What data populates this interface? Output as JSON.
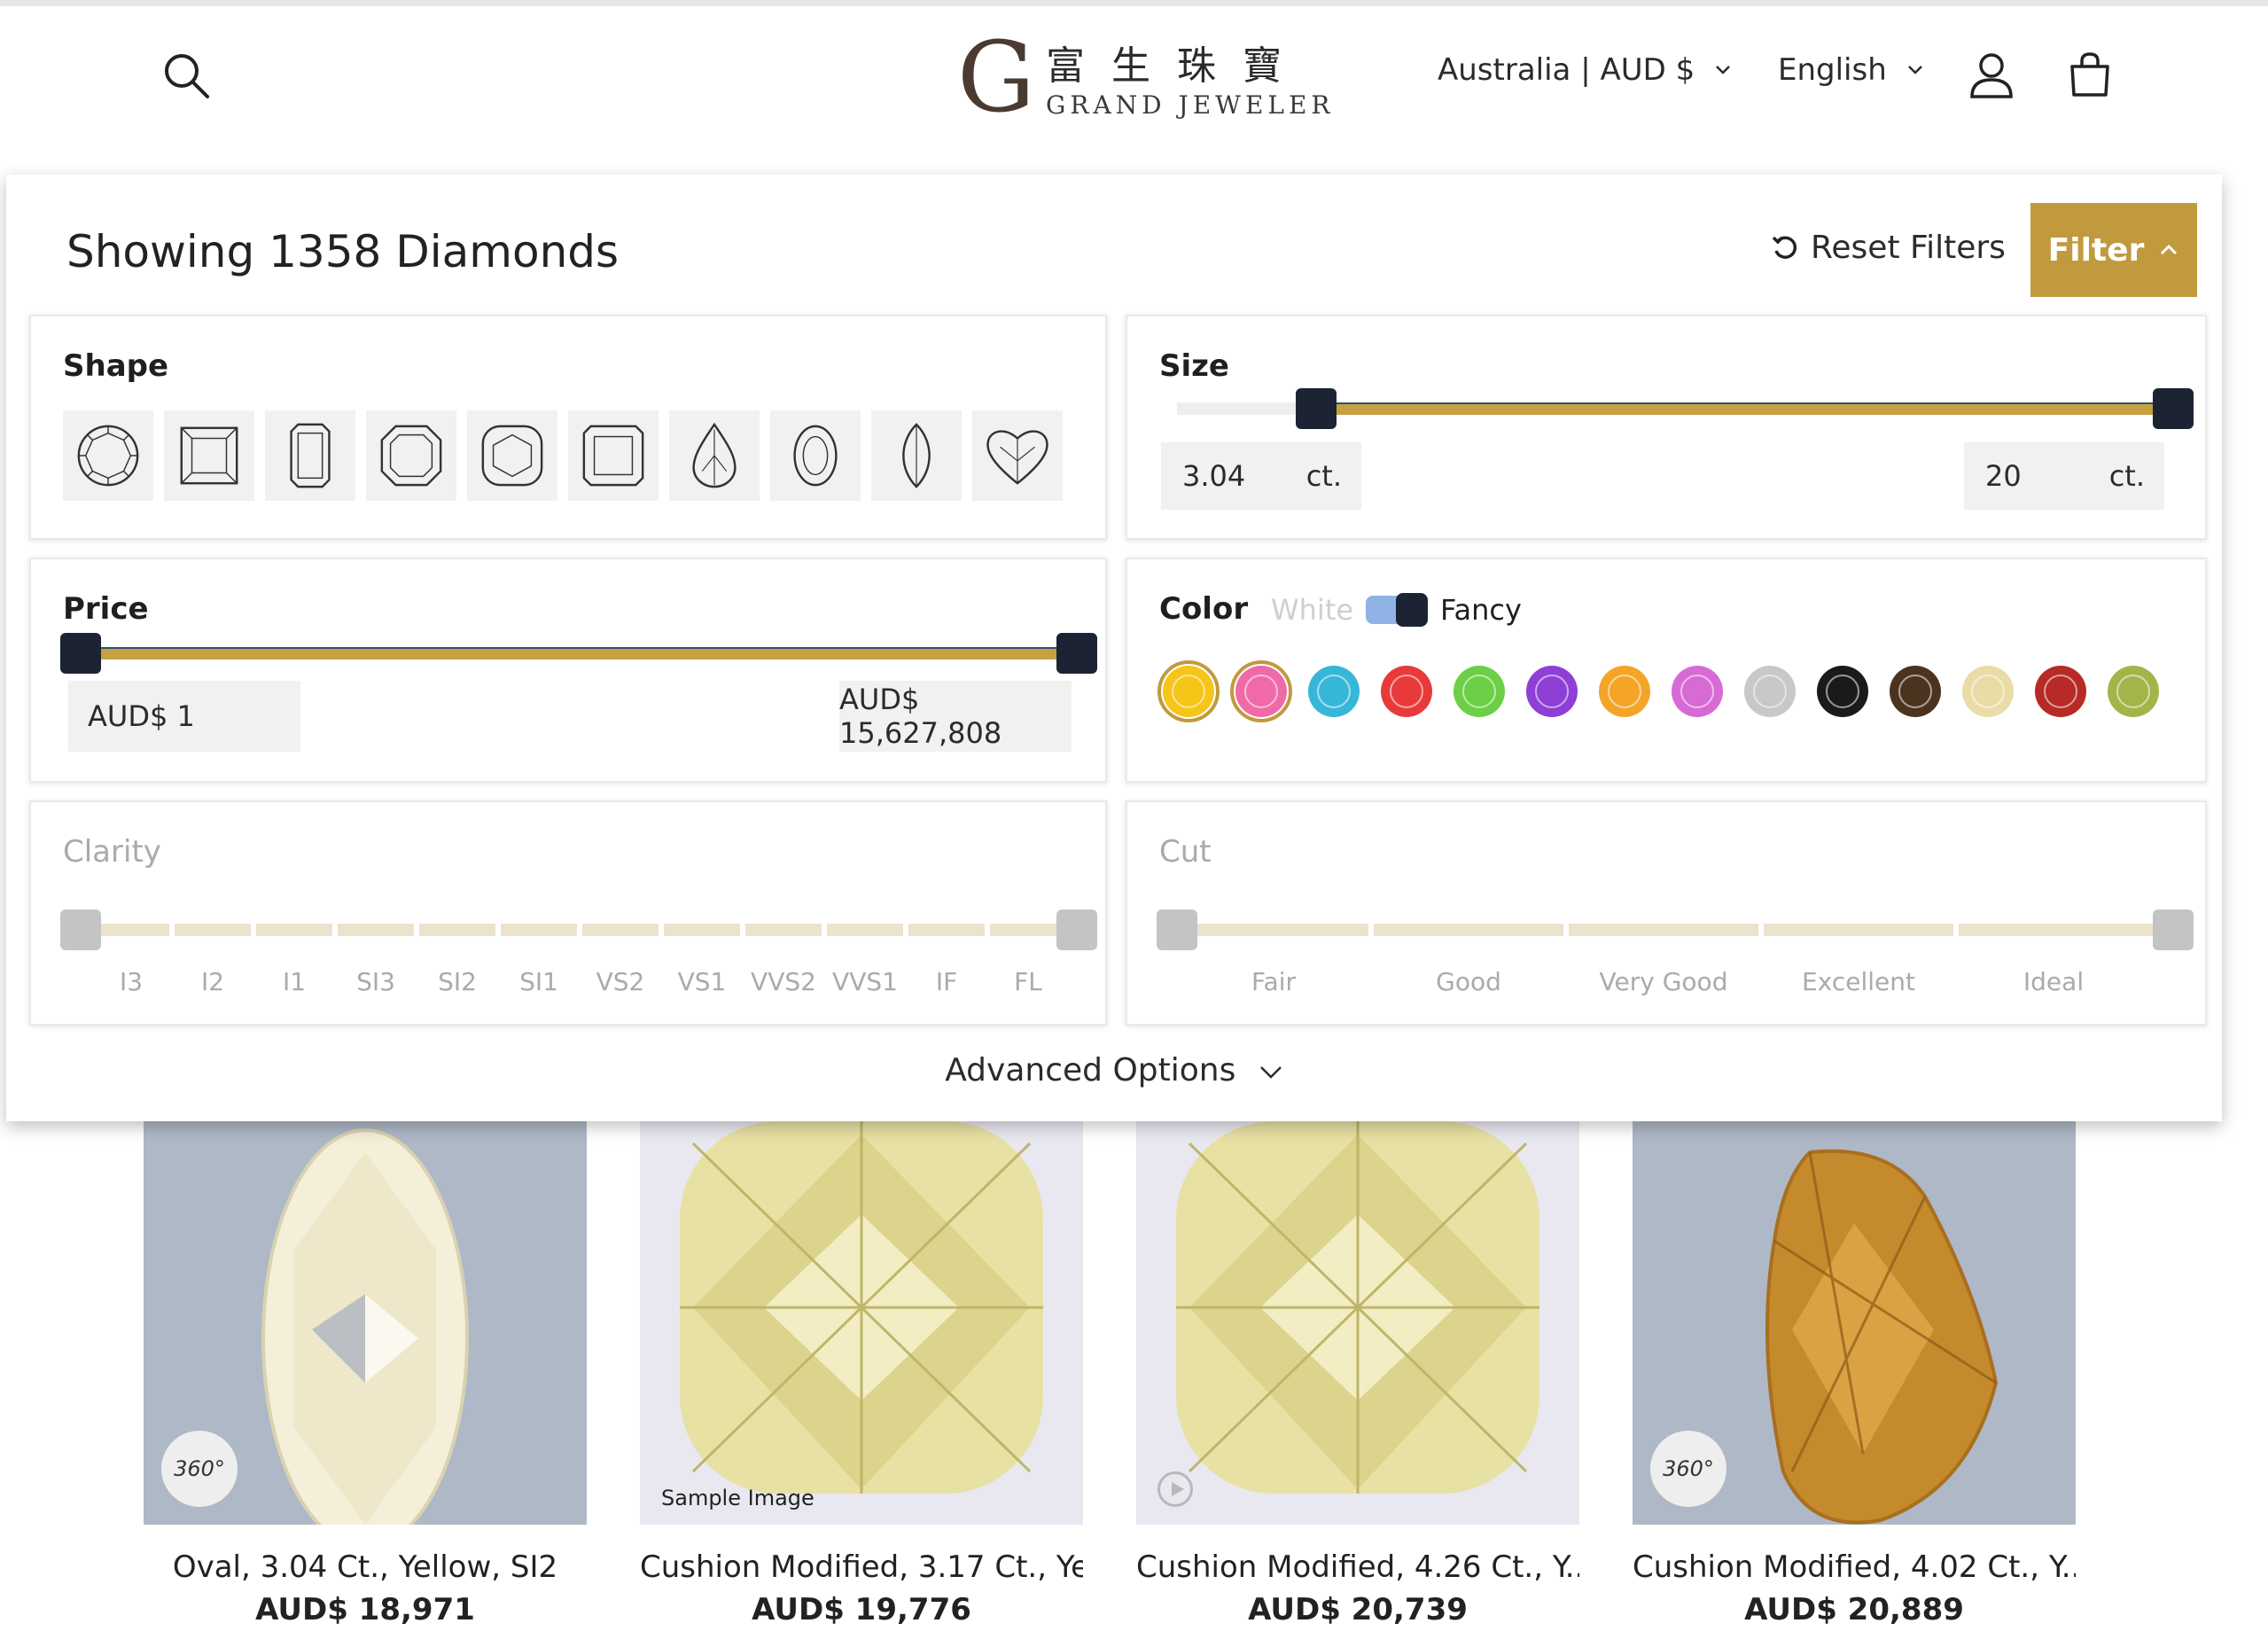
{
  "header": {
    "logo_cn": "富生珠寶",
    "logo_en": "GRAND JEWELER",
    "logo_initial": "G",
    "region": "Australia | AUD $",
    "language": "English"
  },
  "filters": {
    "showing": "Showing 1358 Diamonds",
    "reset_label": "Reset Filters",
    "filter_label": "Filter",
    "accent_color": "#c19a3e",
    "shape": {
      "title": "Shape",
      "items": [
        "round-icon",
        "princess-icon",
        "emerald-icon",
        "asscher-icon",
        "cushion-icon",
        "radiant-icon",
        "pear-icon",
        "oval-icon",
        "marquise-icon",
        "heart-icon"
      ]
    },
    "size": {
      "title": "Size",
      "min": "3.04",
      "max": "20",
      "unit": "ct.",
      "min_frac": 0.14,
      "max_frac": 1.0
    },
    "price": {
      "title": "Price",
      "min": "AUD$ 1",
      "max": "AUD$ 15,627,808",
      "min_frac": 0.0,
      "max_frac": 1.0
    },
    "color": {
      "title": "Color",
      "toggle_off": "White",
      "toggle_on": "Fancy",
      "swatches": [
        {
          "name": "yellow",
          "hex": "#f5c518",
          "selected": true
        },
        {
          "name": "pink",
          "hex": "#f06aa8",
          "selected": true
        },
        {
          "name": "blue",
          "hex": "#37b7d8",
          "selected": false
        },
        {
          "name": "red",
          "hex": "#e83a3a",
          "selected": false
        },
        {
          "name": "green",
          "hex": "#6ccf46",
          "selected": false
        },
        {
          "name": "purple",
          "hex": "#8d3fd6",
          "selected": false
        },
        {
          "name": "orange",
          "hex": "#f4a427",
          "selected": false
        },
        {
          "name": "violet",
          "hex": "#d86ad6",
          "selected": false
        },
        {
          "name": "gray",
          "hex": "#c8c8c8",
          "selected": false
        },
        {
          "name": "black",
          "hex": "#1a1a1a",
          "selected": false
        },
        {
          "name": "brown",
          "hex": "#4a3420",
          "selected": false
        },
        {
          "name": "champagne",
          "hex": "#eadca6",
          "selected": false
        },
        {
          "name": "dark-red",
          "hex": "#b72a25",
          "selected": false
        },
        {
          "name": "olive",
          "hex": "#a3b449",
          "selected": false
        }
      ]
    },
    "clarity": {
      "title": "Clarity",
      "labels": [
        "I3",
        "I2",
        "I1",
        "SI3",
        "SI2",
        "SI1",
        "VS2",
        "VS1",
        "VVS2",
        "VVS1",
        "IF",
        "FL"
      ]
    },
    "cut": {
      "title": "Cut",
      "labels": [
        "Fair",
        "Good",
        "Very Good",
        "Excellent",
        "Ideal"
      ]
    },
    "advanced": "Advanced Options"
  },
  "products": [
    {
      "name": "Oval, 3.04 Ct., Yellow, SI2",
      "price": "AUD$ 18,971",
      "badge": "360°"
    },
    {
      "name": "Cushion Modified, 3.17 Ct., Ye...",
      "price": "AUD$ 19,776",
      "badge": "Sample Image"
    },
    {
      "name": "Cushion Modified, 4.26 Ct., Y...",
      "price": "AUD$ 20,739",
      "badge": "play-icon"
    },
    {
      "name": "Cushion Modified, 4.02 Ct., Y...",
      "price": "AUD$ 20,889",
      "badge": "360°"
    }
  ]
}
